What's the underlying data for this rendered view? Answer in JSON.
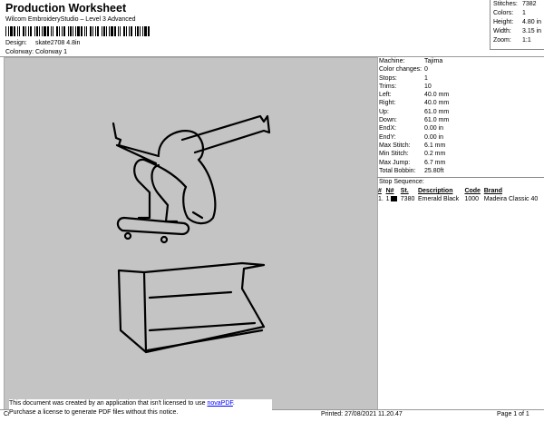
{
  "header": {
    "title": "Production Worksheet",
    "subtitle": "Wilcom EmbroideryStudio – Level 3 Advanced"
  },
  "design_info": [
    {
      "label": "Design:",
      "value": "skate2708 4.8in"
    },
    {
      "label": "Colorway:",
      "value": "Colorway 1"
    }
  ],
  "top_stats": [
    {
      "label": "Stitches:",
      "value": "7382"
    },
    {
      "label": "Colors:",
      "value": "1"
    },
    {
      "label": "Height:",
      "value": "4.80 in"
    },
    {
      "label": "Width:",
      "value": "3.15 in"
    },
    {
      "label": "Zoom:",
      "value": "1:1"
    }
  ],
  "machine_stats": [
    {
      "label": "Machine:",
      "value": "Tajima"
    },
    {
      "label": "Color changes:",
      "value": "0"
    },
    {
      "label": "Stops:",
      "value": "1"
    },
    {
      "label": "Trims:",
      "value": "10"
    },
    {
      "label": "Left:",
      "value": "40.0 mm"
    },
    {
      "label": "Right:",
      "value": "40.0 mm"
    },
    {
      "label": "Up:",
      "value": "61.0 mm"
    },
    {
      "label": "Down:",
      "value": "61.0 mm"
    },
    {
      "label": "EndX:",
      "value": "0.00 in"
    },
    {
      "label": "EndY:",
      "value": "0.00 in"
    },
    {
      "label": "Max Stitch:",
      "value": "6.1 mm"
    },
    {
      "label": "Min Stitch:",
      "value": "0.2 mm"
    },
    {
      "label": "Max Jump:",
      "value": "6.7 mm"
    },
    {
      "label": "Total Bobbin:",
      "value": "25.80ft"
    }
  ],
  "stop_sequence": {
    "heading": "Stop Sequence:",
    "columns": [
      "#",
      "N#",
      "St.",
      "Description",
      "Code",
      "Brand"
    ],
    "rows": [
      {
        "num": "1.",
        "n": "1",
        "swatch_color": "#000000",
        "st": "7380",
        "description": "Emerald Black",
        "code": "1000",
        "brand": "Madeira Classic 40"
      }
    ]
  },
  "notice": {
    "line1_prefix": "This document was created by an application that isn't licensed to use ",
    "link_text": "novaPDF",
    "line1_suffix": ".",
    "line2": "Purchase a license to generate PDF files without this notice."
  },
  "footer": {
    "left": "Cr",
    "printed": "Printed: 27/08/2021 11.20.47",
    "page": "Page 1 of 1"
  }
}
